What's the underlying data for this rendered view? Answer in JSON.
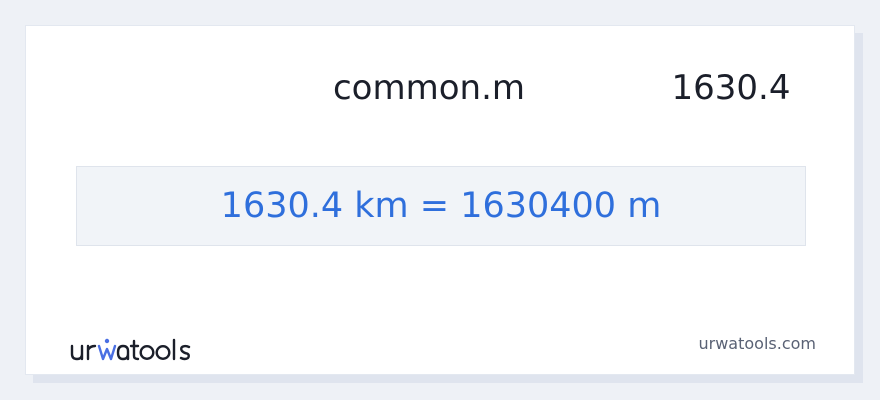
{
  "converter": {
    "unit_label": "common.m",
    "input_value": "1630.4",
    "result": "1630.4 km = 1630400 m"
  },
  "footer": {
    "logo_text": "urwatools",
    "site_url": "urwatools.com"
  },
  "colors": {
    "result_text": "#2f6fdc",
    "logo_dark": "#1b1f2a",
    "logo_accent": "#4a6fe3",
    "card_background": "#ffffff",
    "result_background": "#f1f4f8"
  }
}
